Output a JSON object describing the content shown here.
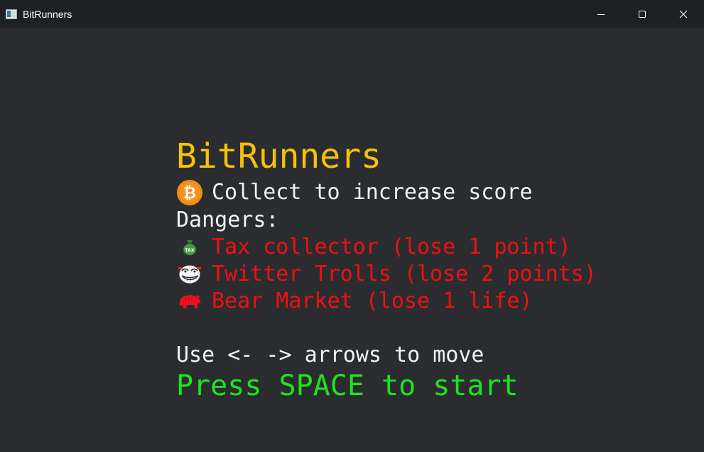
{
  "window": {
    "title": "BitRunners",
    "icon": "app-window-icon",
    "controls": [
      "minimize-icon",
      "maximize-icon",
      "close-icon"
    ]
  },
  "game": {
    "title": "BitRunners",
    "title_color": "#f5c20a",
    "collect": {
      "icon": "bitcoin-coin-icon",
      "text": "Collect to increase score"
    },
    "dangers_label": "Dangers:",
    "dangers": [
      {
        "icon": "tax-bag-icon",
        "text": "Tax collector (lose 1 point)"
      },
      {
        "icon": "troll-face-icon",
        "text": "Twitter Trolls (lose 2 points)"
      },
      {
        "icon": "bear-icon",
        "text": "Bear Market (lose 1 life)"
      }
    ],
    "danger_color": "#ee1111",
    "controls_hint": "Use <- -> arrows to move",
    "start_prompt": "Press SPACE to start",
    "start_color": "#1de51d"
  }
}
